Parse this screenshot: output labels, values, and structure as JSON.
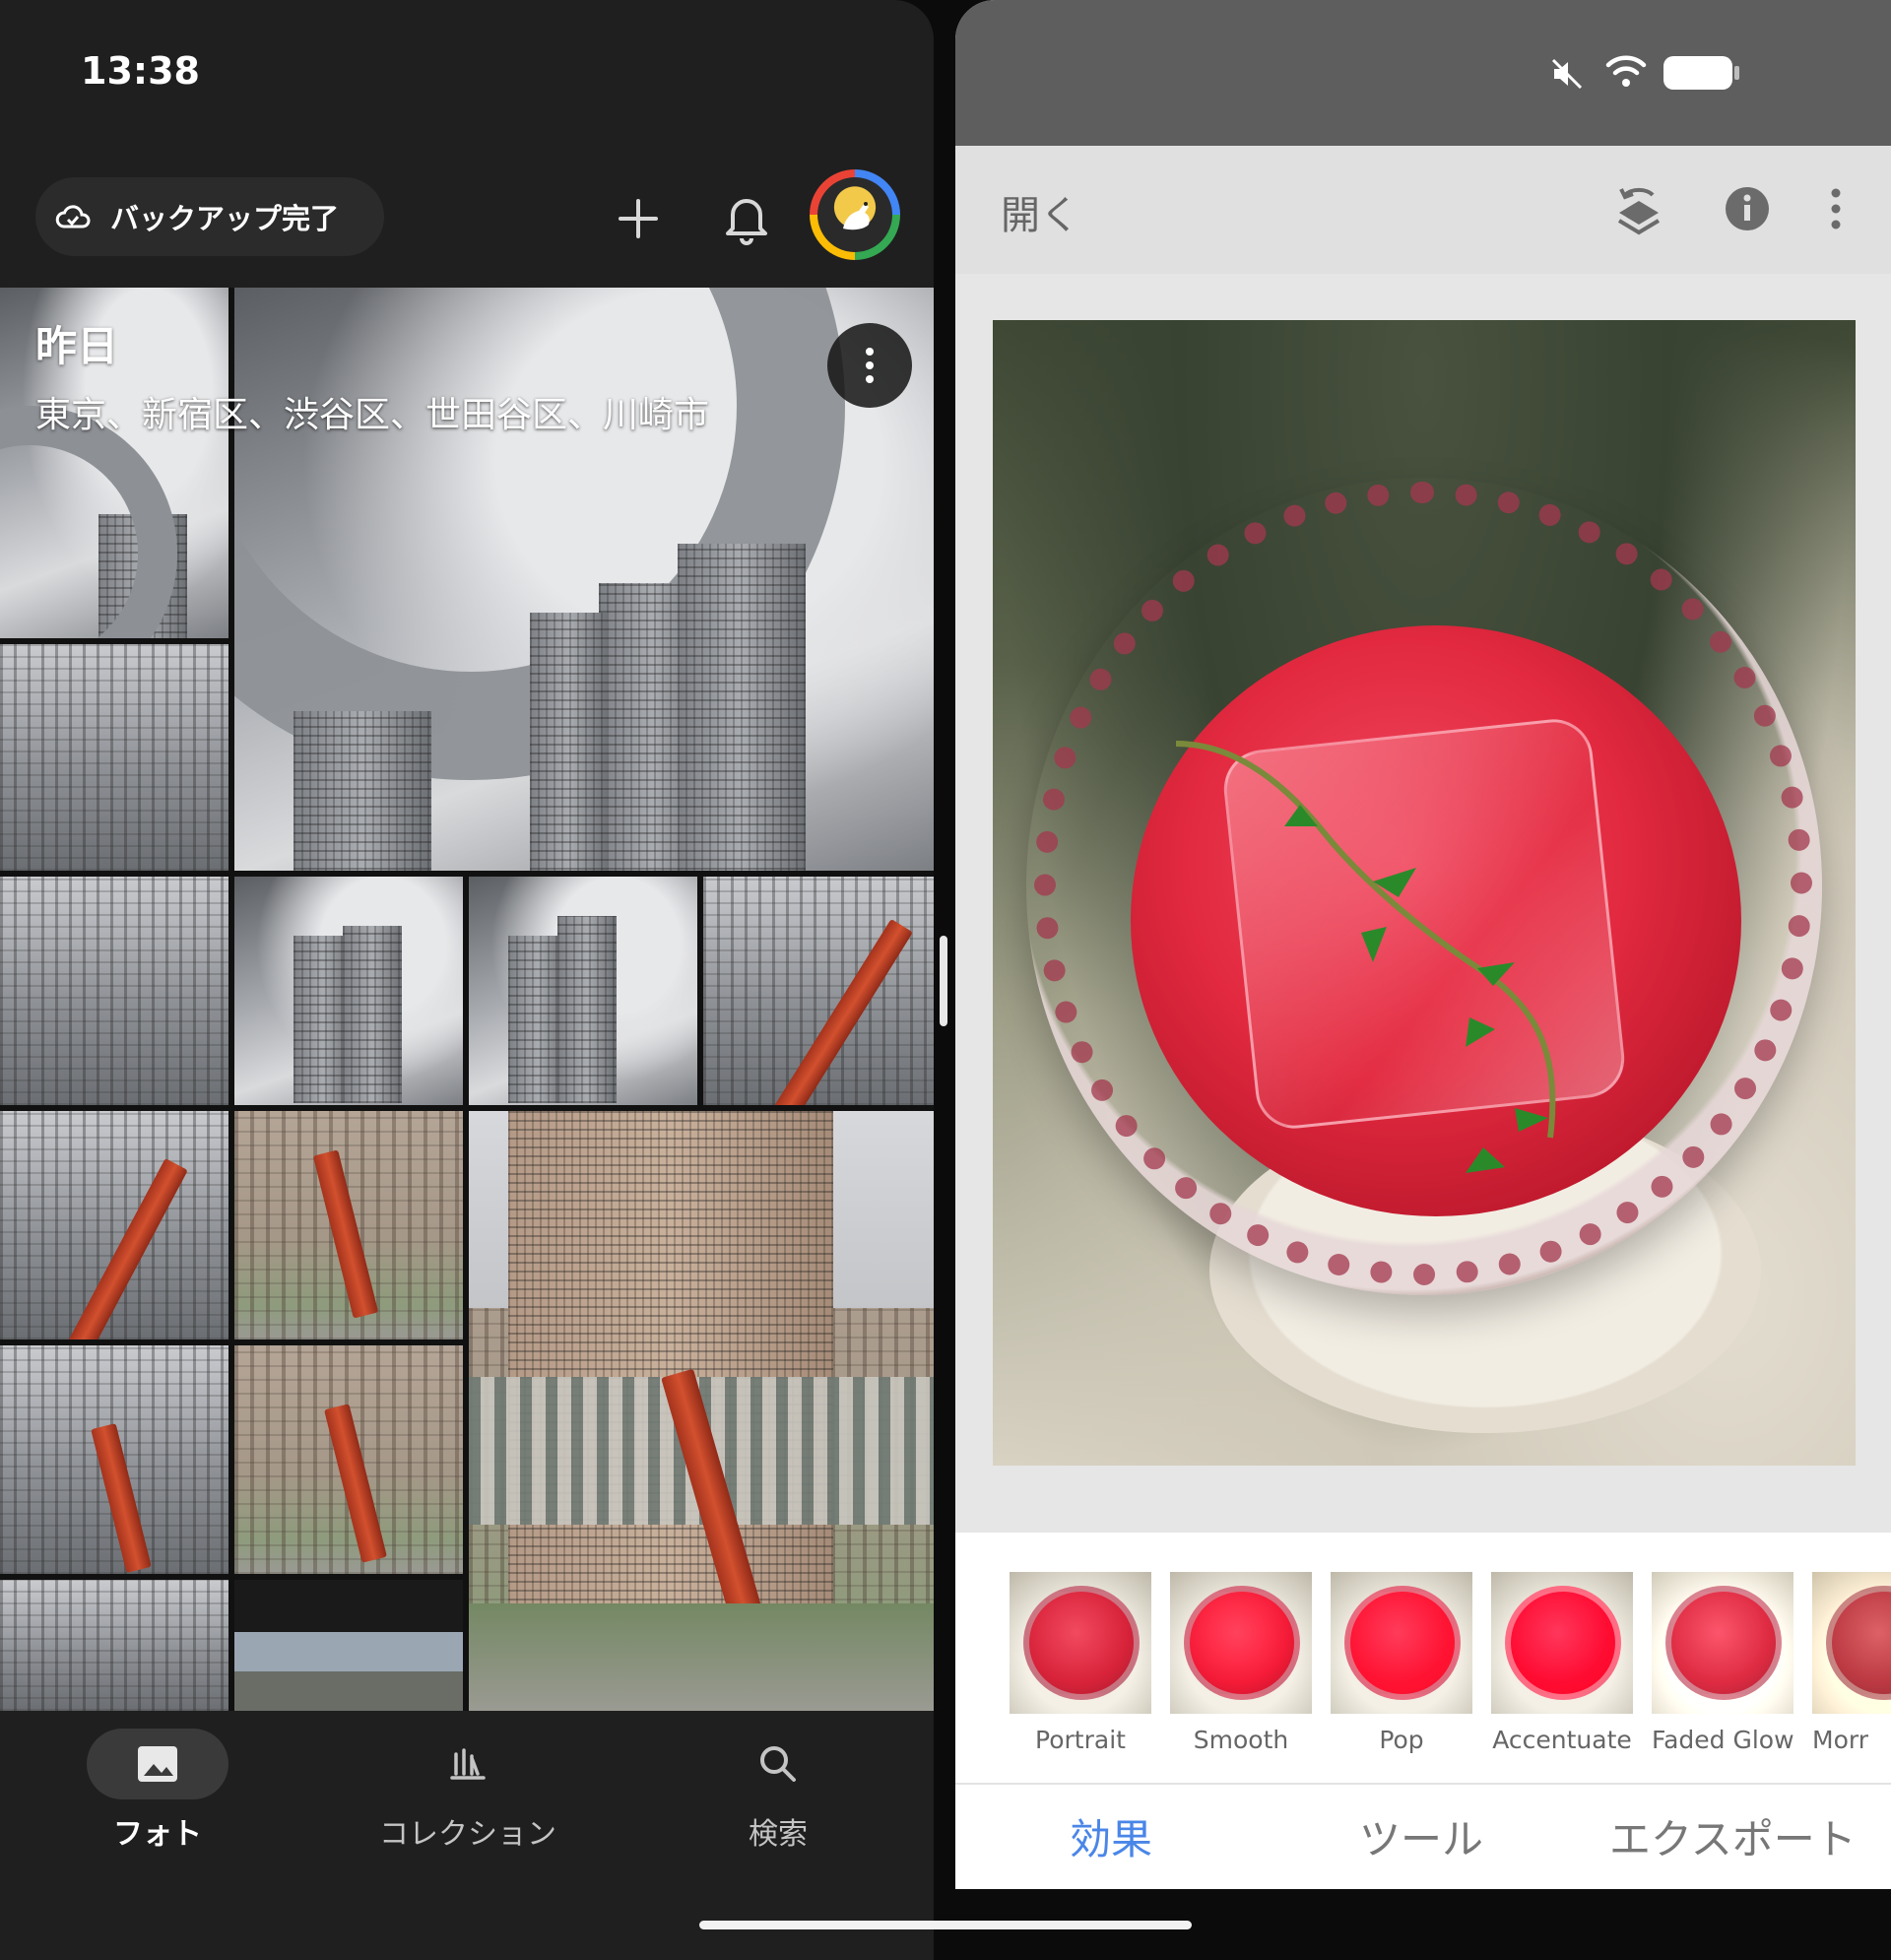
{
  "status": {
    "time": "13:38"
  },
  "photos": {
    "backup_label": "バックアップ完了",
    "section": {
      "title": "昨日",
      "locations": "東京、新宿区、渋谷区、世田谷区、川崎市"
    },
    "nav": [
      {
        "label": "フォト",
        "icon": "photo-icon",
        "active": true
      },
      {
        "label": "コレクション",
        "icon": "library-icon",
        "active": false
      },
      {
        "label": "検索",
        "icon": "search-icon",
        "active": false
      }
    ]
  },
  "snapseed": {
    "open_label": "開く",
    "looks": [
      {
        "label": "Portrait"
      },
      {
        "label": "Smooth"
      },
      {
        "label": "Pop"
      },
      {
        "label": "Accentuate"
      },
      {
        "label": "Faded Glow"
      },
      {
        "label": "Morr"
      }
    ],
    "tabs": [
      {
        "label": "効果",
        "active": true
      },
      {
        "label": "ツール",
        "active": false
      },
      {
        "label": "エクスポート",
        "active": false
      }
    ],
    "colors": {
      "accent": "#4a86e8"
    }
  }
}
